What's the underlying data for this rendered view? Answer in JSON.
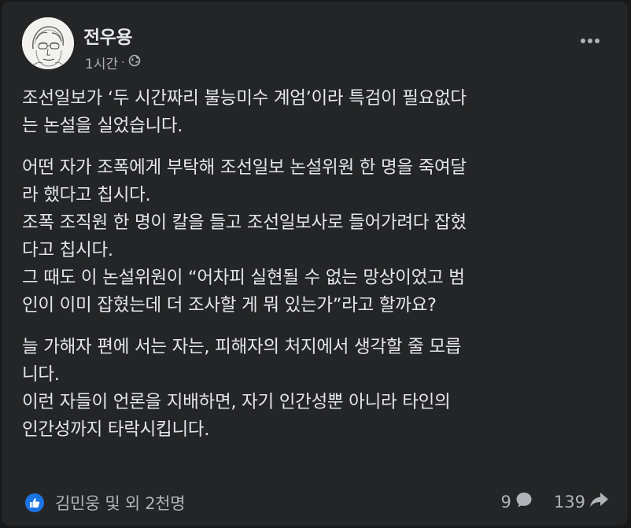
{
  "post": {
    "author": "전우용",
    "time": "1시간",
    "privacy_icon": "globe-icon",
    "menu_icon": "more-horizontal-icon",
    "paragraphs": [
      [
        "조선일보가 ‘두 시간짜리 불능미수 계엄’이라 특검이 필요없다",
        "는 논설을 실었습니다."
      ],
      [
        "어떤 자가 조폭에게 부탁해 조선일보 논설위원 한 명을 죽여달",
        "라 했다고 칩시다.",
        "조폭 조직원 한 명이 칼을 들고 조선일보사로 들어가려다 잡혔",
        "다고 칩시다.",
        "그 때도 이 논설위원이 “어차피 실현될 수 없는 망상이었고 범",
        "인이 이미 잡혔는데 더 조사할 게 뭐 있는가”라고 할까요?"
      ],
      [
        "늘 가해자 편에 서는 자는, 피해자의 처지에서 생각할 줄 모릅",
        "니다.",
        "이런 자들이 언론을 지배하면,  자기 인간성뿐 아니라 타인의",
        "인간성까지 타락시킵니다."
      ]
    ]
  },
  "footer": {
    "reactions_text": "김민웅 및 외 2천명",
    "comments_count": "9",
    "shares_count": "139"
  },
  "colors": {
    "card_bg": "#242526",
    "text": "#e4e6eb",
    "secondary": "#b0b3b8",
    "like_blue": "#1b74e4"
  }
}
